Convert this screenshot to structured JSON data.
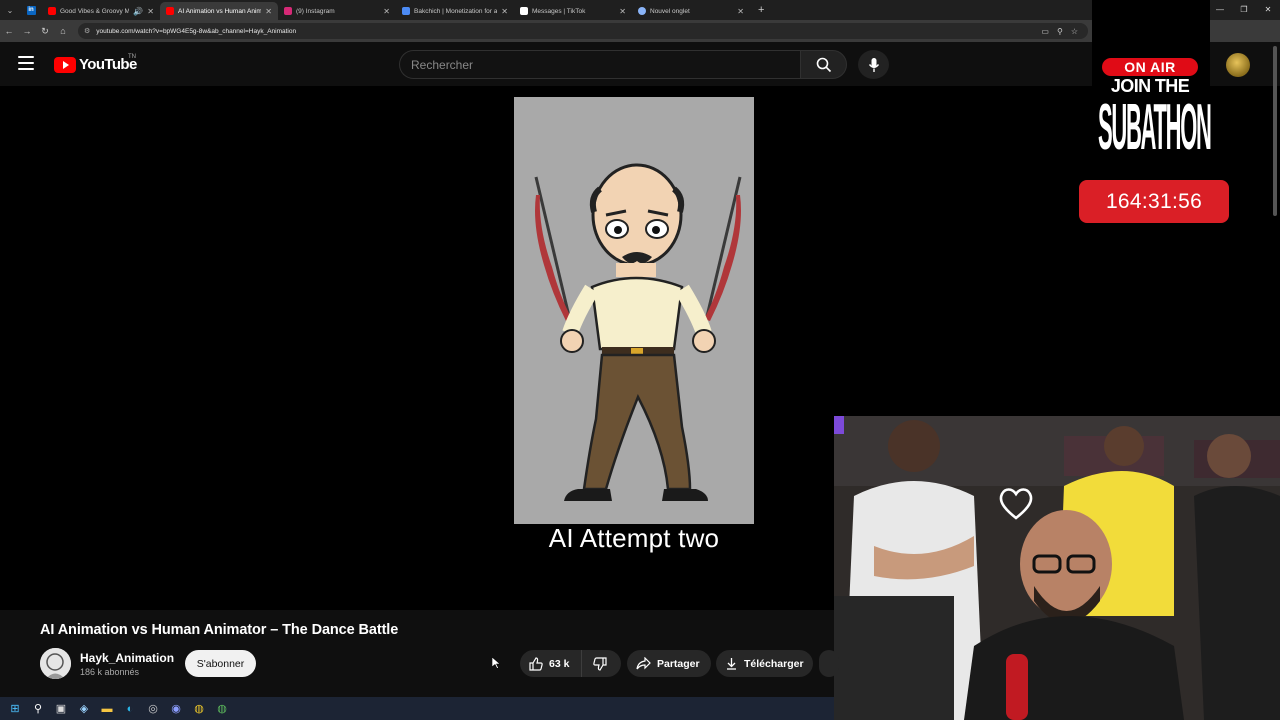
{
  "browser": {
    "tabs": [
      {
        "title": "Good Vibes & Groovy Moo",
        "active": false,
        "color": "#ff0000"
      },
      {
        "title": "AI Animation vs Human Animat",
        "active": true,
        "color": "#ff0000"
      },
      {
        "title": "(9) Instagram",
        "active": false,
        "color": "#d62976"
      },
      {
        "title": "Bakchich | Monetization for aff",
        "active": false,
        "color": "#4c8bf5"
      },
      {
        "title": "Messages | TikTok",
        "active": false,
        "color": "#ffffff"
      },
      {
        "title": "Nouvel onglet",
        "active": false,
        "color": "#8ab4f8"
      }
    ],
    "url": "youtube.com/watch?v=bpWG4E5g-8w&ab_channel=Hayk_Animation"
  },
  "masthead": {
    "logo_text": "YouTube",
    "country_code": "TN",
    "search_placeholder": "Rechercher"
  },
  "video": {
    "caption": "AI Attempt two"
  },
  "overlay": {
    "on_air": "ON AIR",
    "join_the": "JOIN THE",
    "subathon": "SUBATHON",
    "timer": "164:31:56"
  },
  "video_info": {
    "title": "AI Animation vs Human Animator – The Dance Battle",
    "channel_name": "Hayk_Animation",
    "subscribers": "186 k abonnés",
    "subscribe_label": "S'abonner",
    "like_count": "63 k",
    "share_label": "Partager",
    "download_label": "Télécharger"
  },
  "colors": {
    "youtube_red": "#ff0000",
    "timer_red": "#da1f26",
    "page_bg": "#0f0f0f"
  },
  "icons": [
    "menu-icon",
    "search-icon",
    "mic-icon",
    "like-icon",
    "dislike-icon",
    "share-icon",
    "download-icon",
    "heart-icon"
  ]
}
